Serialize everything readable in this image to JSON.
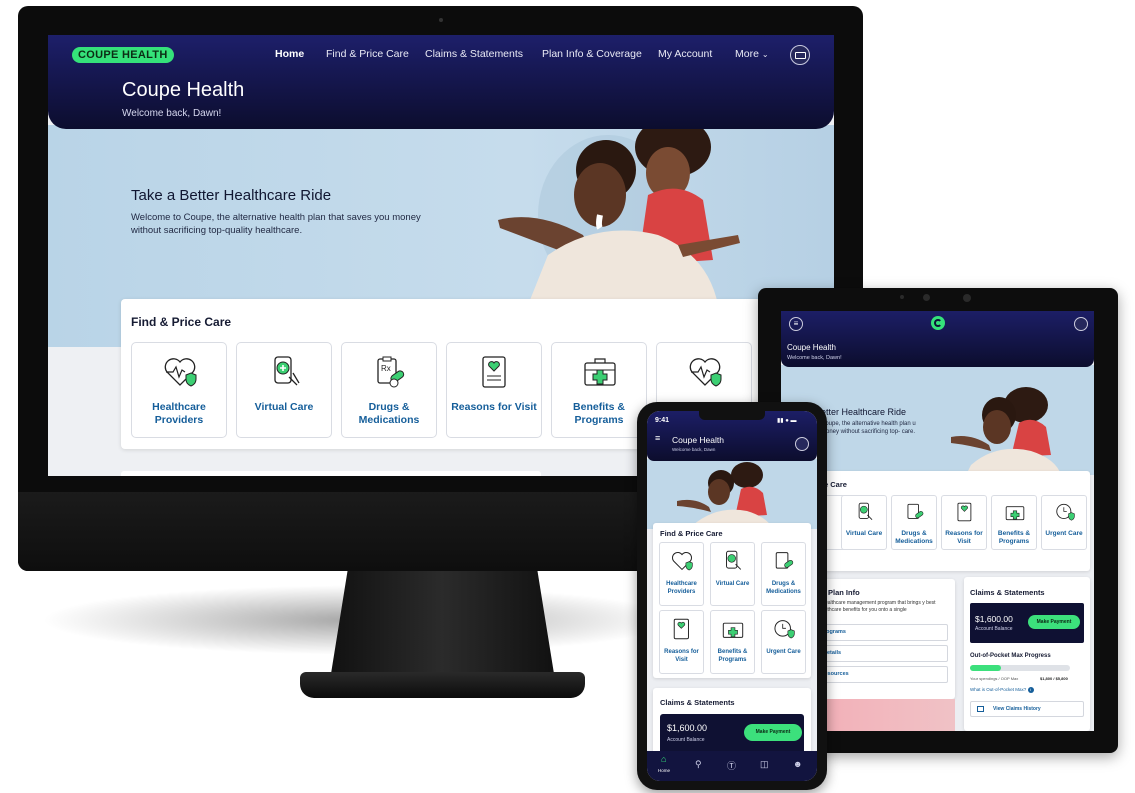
{
  "desktop": {
    "brand_pill": "COUPE HEALTH",
    "nav": [
      "Home",
      "Find & Price Care",
      "Claims & Statements",
      "Plan Info & Coverage",
      "My Account",
      "More"
    ],
    "title": "Coupe Health",
    "welcome": "Welcome back, Dawn!",
    "hero_title": "Take a Better Healthcare Ride",
    "hero_body": "Welcome to Coupe, the alternative health plan that saves you money without sacrificing top-quality healthcare.",
    "find_care_title": "Find & Price Care",
    "tiles": [
      {
        "label": "Healthcare Providers",
        "icon": "heart-shield-icon"
      },
      {
        "label": "Virtual Care",
        "icon": "phone-medical-icon"
      },
      {
        "label": "Drugs & Medications",
        "icon": "rx-clipboard-icon"
      },
      {
        "label": "Reasons for Visit",
        "icon": "document-heart-icon"
      },
      {
        "label": "Benefits & Programs",
        "icon": "medkit-icon"
      },
      {
        "label": "",
        "icon": "heart-shield-icon"
      }
    ]
  },
  "tablet": {
    "title": "Coupe Health",
    "welcome": "Welcome back, Dawn!",
    "hero_title": "etter Healthcare Ride",
    "hero_body": "Coupe, the alternative health plan u money without sacrificing top- care.",
    "find_care_title": "e Care",
    "tiles": [
      "s",
      "Virtual Care",
      "Drugs & Medications",
      "Reasons for Visit",
      "Benefits & Programs",
      "Urgent Care"
    ],
    "plan_title": "Plan Info",
    "plan_body": "a healthcare management program that brings y best healthcare benefits for you onto a single",
    "plan_links": [
      "fits & Programs",
      "h Plan Details",
      "macy Resources"
    ],
    "claims_title": "Claims & Statements",
    "balance": "$1,600.00",
    "balance_label": "Account Balance",
    "pay_button": "Make Payment",
    "oop_title": "Out-of-Pocket Max Progress",
    "oop_caption": "Your spendings / OOP Max",
    "oop_values": "$1,800 / $5,800",
    "oop_progress": 0.31,
    "oop_link": "What is Out-of-Pocket Max?",
    "history_link": "View Claims History"
  },
  "phone": {
    "time": "9:41",
    "title": "Coupe Health",
    "welcome": "Welcome back, Dawn",
    "find_care_title": "Find & Price Care",
    "tiles": [
      "Healthcare Providers",
      "Virtual Care",
      "Drugs & Medications",
      "Reasons for Visit",
      "Benefits & Programs",
      "Urgent Care"
    ],
    "claims_title": "Claims & Statements",
    "balance": "$1,600.00",
    "balance_label": "Account Balance",
    "pay_button": "Make Payment",
    "tab_home": "Home"
  },
  "colors": {
    "navy": "#1c1e66",
    "green": "#35e27a",
    "link_blue": "#155e9a",
    "hero_blue": "#bfd7e8"
  }
}
